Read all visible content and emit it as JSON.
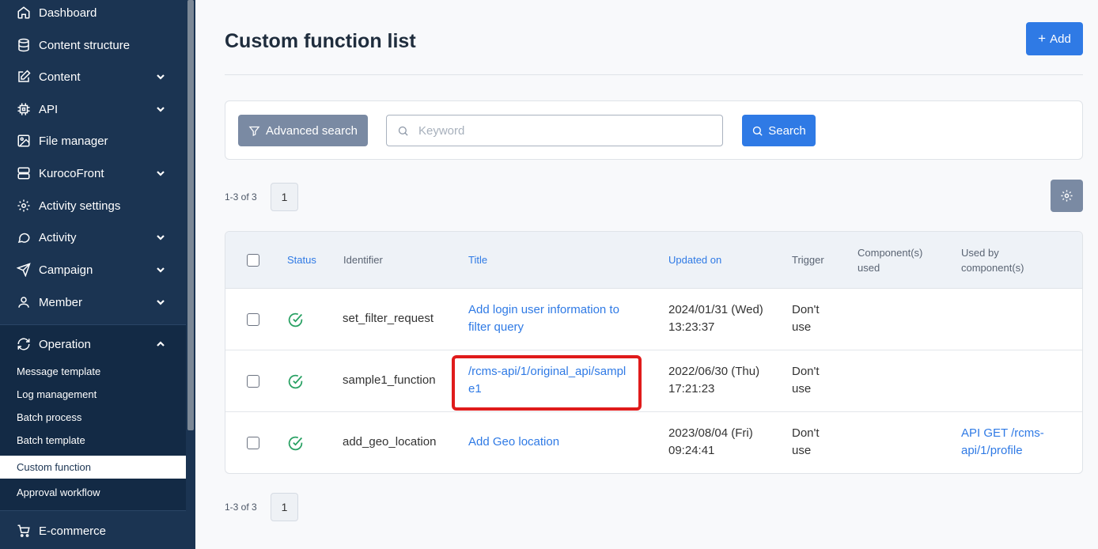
{
  "sidebar": {
    "items": [
      {
        "label": "Dashboard",
        "icon": "home-icon"
      },
      {
        "label": "Content structure",
        "icon": "database-icon"
      },
      {
        "label": "Content",
        "icon": "edit-icon"
      },
      {
        "label": "API",
        "icon": "chip-icon"
      },
      {
        "label": "File manager",
        "icon": "image-icon"
      },
      {
        "label": "KurocoFront",
        "icon": "server-icon"
      },
      {
        "label": "Activity settings",
        "icon": "gear-icon"
      },
      {
        "label": "Activity",
        "icon": "chat-icon"
      },
      {
        "label": "Campaign",
        "icon": "send-icon"
      },
      {
        "label": "Member",
        "icon": "user-icon"
      },
      {
        "label": "Operation",
        "icon": "refresh-icon"
      },
      {
        "label": "E-commerce",
        "icon": "cart-icon"
      }
    ],
    "operation_sub": [
      "Message template",
      "Log management",
      "Batch process",
      "Batch template",
      "Custom function",
      "Approval workflow"
    ]
  },
  "page": {
    "title": "Custom function list",
    "add_label": "Add"
  },
  "search": {
    "advanced_label": "Advanced search",
    "keyword_placeholder": "Keyword",
    "search_label": "Search"
  },
  "pagination": {
    "summary": "1-3 of 3",
    "page": "1"
  },
  "table": {
    "headers": [
      "Status",
      "Identifier",
      "Title",
      "Updated on",
      "Trigger",
      "Component(s) used",
      "Used by component(s)"
    ],
    "rows": [
      {
        "identifier": "set_filter_request",
        "title": "Add login user information to filter query",
        "updated": "2024/01/31 (Wed) 13:23:37",
        "trigger": "Don't use",
        "used_by": ""
      },
      {
        "identifier": "sample1_function",
        "title": "/rcms-api/1/original_api/sample1",
        "updated": "2022/06/30 (Thu) 17:21:23",
        "trigger": "Don't use",
        "used_by": ""
      },
      {
        "identifier": "add_geo_location",
        "title": "Add Geo location",
        "updated": "2023/08/04 (Fri) 09:24:41",
        "trigger": "Don't use",
        "used_by": "API GET /rcms-api/1/profile"
      }
    ]
  },
  "colors": {
    "sidebar": "#1b3452",
    "primary": "#2f7ae5",
    "secondary": "#7a8aa3",
    "status_ok": "#27a062",
    "highlight": "#e01b1b"
  }
}
